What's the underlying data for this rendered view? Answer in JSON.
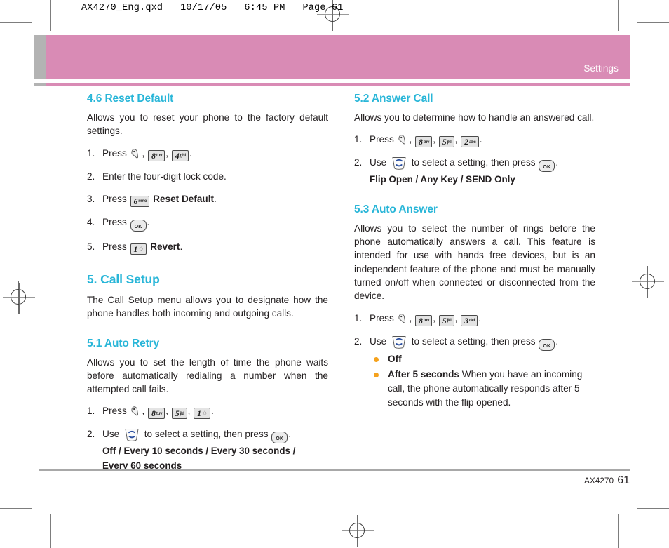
{
  "file_header": "AX4270_Eng.qxd   10/17/05   6:45 PM   Page 61",
  "banner": {
    "title": "Settings"
  },
  "footer": {
    "model": "AX4270",
    "page_number": "61"
  },
  "colors": {
    "heading": "#29b6d8",
    "banner": "#d98bb5",
    "banner_tab": "#b3b3b3",
    "bullet": "#f5a21d",
    "body_text": "#231f20"
  },
  "keys": {
    "menu": "menu-key",
    "ok": "OK",
    "nav": "navigation-key",
    "k8": {
      "digit": "8",
      "letters": "tuv"
    },
    "k5": {
      "digit": "5",
      "letters": "jkl"
    },
    "k4": {
      "digit": "4",
      "letters": "ghi"
    },
    "k2": {
      "digit": "2",
      "letters": "abc"
    },
    "k3": {
      "digit": "3",
      "letters": "def"
    },
    "k6": {
      "digit": "6",
      "letters": "mno"
    },
    "k1": {
      "digit": "1",
      "letters": ""
    }
  },
  "left_column": {
    "reset_default": {
      "heading": "4.6 Reset Default",
      "intro": "Allows you to reset your phone to the factory default settings.",
      "steps": [
        {
          "num": "1.",
          "label": "Press"
        },
        {
          "num": "2.",
          "label": "Enter the four-digit lock code."
        },
        {
          "num": "3.",
          "label": "Press",
          "bold_after": "Reset Default"
        },
        {
          "num": "4.",
          "label": "Press"
        },
        {
          "num": "5.",
          "label": "Press",
          "bold_after": "Revert"
        }
      ]
    },
    "call_setup": {
      "heading": "5. Call Setup",
      "intro": "The Call Setup menu allows you to designate how the phone handles both incoming and outgoing calls."
    },
    "auto_retry": {
      "heading": "5.1 Auto Retry",
      "intro": "Allows you to set the length of time the phone waits before automatically redialing a number when the attempted call fails.",
      "step1_num": "1.",
      "step1_label": "Press",
      "step2_num": "2.",
      "step2_label_a": "Use",
      "step2_label_b": "to select a setting, then press",
      "options_line1": "Off / Every 10 seconds / Every 30 seconds /",
      "options_line2": "Every 60 seconds"
    }
  },
  "right_column": {
    "answer_call": {
      "heading": "5.2 Answer Call",
      "intro": "Allows you to determine how to handle an answered call.",
      "step1_num": "1.",
      "step1_label": "Press",
      "step2_num": "2.",
      "step2_label_a": "Use",
      "step2_label_b": "to select a setting, then press",
      "options": "Flip Open / Any Key / SEND Only"
    },
    "auto_answer": {
      "heading": "5.3 Auto Answer",
      "intro": "Allows you to select the number of rings before the phone automatically answers a call. This feature is intended for use with hands free devices, but is an independent feature of the phone and must be manually turned on/off when connected or disconnected from the device.",
      "step1_num": "1.",
      "step1_label": "Press",
      "step2_num": "2.",
      "step2_label_a": "Use",
      "step2_label_b": "to select a setting, then press",
      "bullets": [
        {
          "bold": "Off",
          "rest": ""
        },
        {
          "bold": "After 5 seconds",
          "rest": " When you have an incoming call, the phone automatically responds after 5 seconds with the flip opened."
        }
      ]
    }
  }
}
